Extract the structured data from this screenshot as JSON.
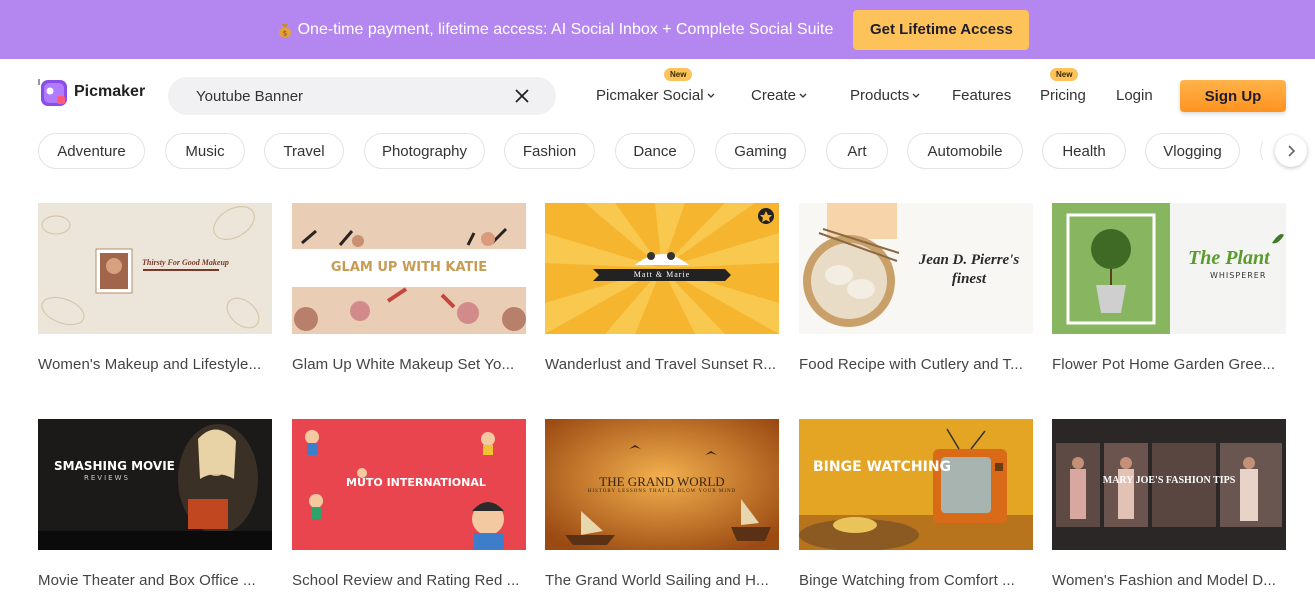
{
  "promo": {
    "text": "One-time payment, lifetime access: AI Social Inbox + Complete Social Suite",
    "icon": "money-bag-icon",
    "button": "Get Lifetime Access"
  },
  "nav": {
    "logo": "Picmaker",
    "search_value": "Youtube Banner",
    "items": [
      {
        "label": "Picmaker Social",
        "badge": "New",
        "dropdown": true
      },
      {
        "label": "Create",
        "dropdown": true
      },
      {
        "label": "Products",
        "dropdown": true
      },
      {
        "label": "Features",
        "dropdown": false
      },
      {
        "label": "Pricing",
        "badge": "New",
        "dropdown": false
      },
      {
        "label": "Login",
        "dropdown": false
      }
    ],
    "signup": "Sign Up"
  },
  "categories": [
    "Adventure",
    "Music",
    "Travel",
    "Photography",
    "Fashion",
    "Dance",
    "Gaming",
    "Art",
    "Automobile",
    "Health",
    "Vlogging"
  ],
  "templates": [
    {
      "title": "Women's Makeup and Lifestyle...",
      "thumb_text": "Thirsty For Good Makeup"
    },
    {
      "title": "Glam Up White Makeup Set Yo...",
      "thumb_text": "GLAM UP WITH KATIE"
    },
    {
      "title": "Wanderlust and Travel Sunset R...",
      "thumb_text": "Matt & Marie"
    },
    {
      "title": "Food Recipe with Cutlery and T...",
      "thumb_text": "Jean D. Pierre's finest"
    },
    {
      "title": "Flower Pot Home Garden Gree...",
      "thumb_text": "The Plant",
      "thumb_sub": "WHISPERER"
    },
    {
      "title": "Movie Theater and Box Office ...",
      "thumb_text": "SMASHING MOVIE",
      "thumb_sub": "REVIEWS"
    },
    {
      "title": "School Review and Rating Red ...",
      "thumb_text": "MUTO INTERNATIONAL"
    },
    {
      "title": "The Grand World Sailing and H...",
      "thumb_text": "THE GRAND WORLD",
      "thumb_sub": "HISTORY LESSONS THAT'LL BLOW YOUR MIND"
    },
    {
      "title": "Binge Watching from Comfort ...",
      "thumb_text": "BINGE WATCHING"
    },
    {
      "title": "Women's Fashion and Model D...",
      "thumb_text": "MARY JOE'S FASHION TIPS"
    }
  ],
  "colors": {
    "promo_bg": "#b486f0",
    "accent": "#fdc25a",
    "signup": "#ff9f30"
  }
}
